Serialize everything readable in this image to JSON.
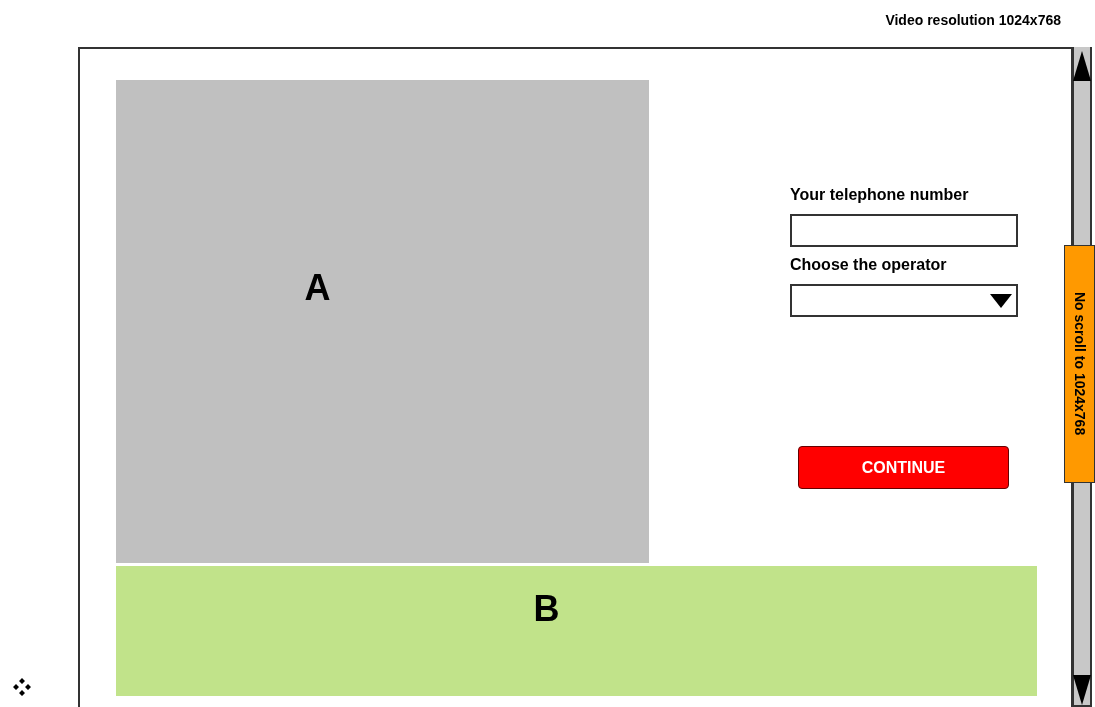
{
  "header": {
    "title": "Video resolution 1024x768"
  },
  "panels": [
    {
      "label": "A"
    },
    {
      "label": "B"
    }
  ],
  "form": {
    "phone_label": "Your telephone number",
    "operator_label": "Choose the operator",
    "button": "CONTINUE"
  },
  "side_note": "No scroll to 1024x768"
}
